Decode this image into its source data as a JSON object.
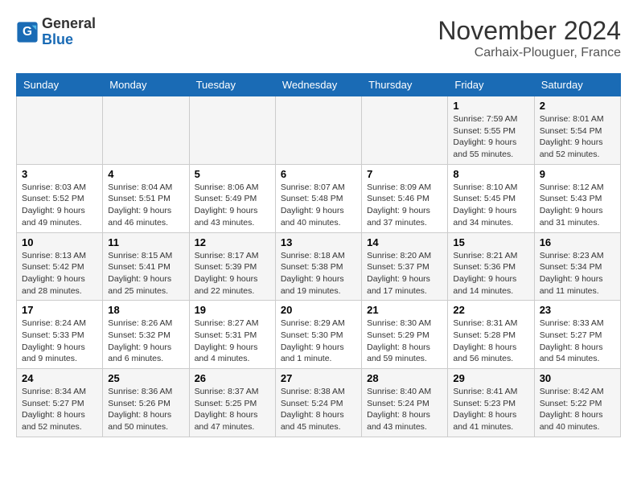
{
  "logo": {
    "text_general": "General",
    "text_blue": "Blue"
  },
  "title": "November 2024",
  "subtitle": "Carhaix-Plouguer, France",
  "days_of_week": [
    "Sunday",
    "Monday",
    "Tuesday",
    "Wednesday",
    "Thursday",
    "Friday",
    "Saturday"
  ],
  "weeks": [
    [
      {
        "day": "",
        "info": ""
      },
      {
        "day": "",
        "info": ""
      },
      {
        "day": "",
        "info": ""
      },
      {
        "day": "",
        "info": ""
      },
      {
        "day": "",
        "info": ""
      },
      {
        "day": "1",
        "info": "Sunrise: 7:59 AM\nSunset: 5:55 PM\nDaylight: 9 hours and 55 minutes."
      },
      {
        "day": "2",
        "info": "Sunrise: 8:01 AM\nSunset: 5:54 PM\nDaylight: 9 hours and 52 minutes."
      }
    ],
    [
      {
        "day": "3",
        "info": "Sunrise: 8:03 AM\nSunset: 5:52 PM\nDaylight: 9 hours and 49 minutes."
      },
      {
        "day": "4",
        "info": "Sunrise: 8:04 AM\nSunset: 5:51 PM\nDaylight: 9 hours and 46 minutes."
      },
      {
        "day": "5",
        "info": "Sunrise: 8:06 AM\nSunset: 5:49 PM\nDaylight: 9 hours and 43 minutes."
      },
      {
        "day": "6",
        "info": "Sunrise: 8:07 AM\nSunset: 5:48 PM\nDaylight: 9 hours and 40 minutes."
      },
      {
        "day": "7",
        "info": "Sunrise: 8:09 AM\nSunset: 5:46 PM\nDaylight: 9 hours and 37 minutes."
      },
      {
        "day": "8",
        "info": "Sunrise: 8:10 AM\nSunset: 5:45 PM\nDaylight: 9 hours and 34 minutes."
      },
      {
        "day": "9",
        "info": "Sunrise: 8:12 AM\nSunset: 5:43 PM\nDaylight: 9 hours and 31 minutes."
      }
    ],
    [
      {
        "day": "10",
        "info": "Sunrise: 8:13 AM\nSunset: 5:42 PM\nDaylight: 9 hours and 28 minutes."
      },
      {
        "day": "11",
        "info": "Sunrise: 8:15 AM\nSunset: 5:41 PM\nDaylight: 9 hours and 25 minutes."
      },
      {
        "day": "12",
        "info": "Sunrise: 8:17 AM\nSunset: 5:39 PM\nDaylight: 9 hours and 22 minutes."
      },
      {
        "day": "13",
        "info": "Sunrise: 8:18 AM\nSunset: 5:38 PM\nDaylight: 9 hours and 19 minutes."
      },
      {
        "day": "14",
        "info": "Sunrise: 8:20 AM\nSunset: 5:37 PM\nDaylight: 9 hours and 17 minutes."
      },
      {
        "day": "15",
        "info": "Sunrise: 8:21 AM\nSunset: 5:36 PM\nDaylight: 9 hours and 14 minutes."
      },
      {
        "day": "16",
        "info": "Sunrise: 8:23 AM\nSunset: 5:34 PM\nDaylight: 9 hours and 11 minutes."
      }
    ],
    [
      {
        "day": "17",
        "info": "Sunrise: 8:24 AM\nSunset: 5:33 PM\nDaylight: 9 hours and 9 minutes."
      },
      {
        "day": "18",
        "info": "Sunrise: 8:26 AM\nSunset: 5:32 PM\nDaylight: 9 hours and 6 minutes."
      },
      {
        "day": "19",
        "info": "Sunrise: 8:27 AM\nSunset: 5:31 PM\nDaylight: 9 hours and 4 minutes."
      },
      {
        "day": "20",
        "info": "Sunrise: 8:29 AM\nSunset: 5:30 PM\nDaylight: 9 hours and 1 minute."
      },
      {
        "day": "21",
        "info": "Sunrise: 8:30 AM\nSunset: 5:29 PM\nDaylight: 8 hours and 59 minutes."
      },
      {
        "day": "22",
        "info": "Sunrise: 8:31 AM\nSunset: 5:28 PM\nDaylight: 8 hours and 56 minutes."
      },
      {
        "day": "23",
        "info": "Sunrise: 8:33 AM\nSunset: 5:27 PM\nDaylight: 8 hours and 54 minutes."
      }
    ],
    [
      {
        "day": "24",
        "info": "Sunrise: 8:34 AM\nSunset: 5:27 PM\nDaylight: 8 hours and 52 minutes."
      },
      {
        "day": "25",
        "info": "Sunrise: 8:36 AM\nSunset: 5:26 PM\nDaylight: 8 hours and 50 minutes."
      },
      {
        "day": "26",
        "info": "Sunrise: 8:37 AM\nSunset: 5:25 PM\nDaylight: 8 hours and 47 minutes."
      },
      {
        "day": "27",
        "info": "Sunrise: 8:38 AM\nSunset: 5:24 PM\nDaylight: 8 hours and 45 minutes."
      },
      {
        "day": "28",
        "info": "Sunrise: 8:40 AM\nSunset: 5:24 PM\nDaylight: 8 hours and 43 minutes."
      },
      {
        "day": "29",
        "info": "Sunrise: 8:41 AM\nSunset: 5:23 PM\nDaylight: 8 hours and 41 minutes."
      },
      {
        "day": "30",
        "info": "Sunrise: 8:42 AM\nSunset: 5:22 PM\nDaylight: 8 hours and 40 minutes."
      }
    ]
  ]
}
